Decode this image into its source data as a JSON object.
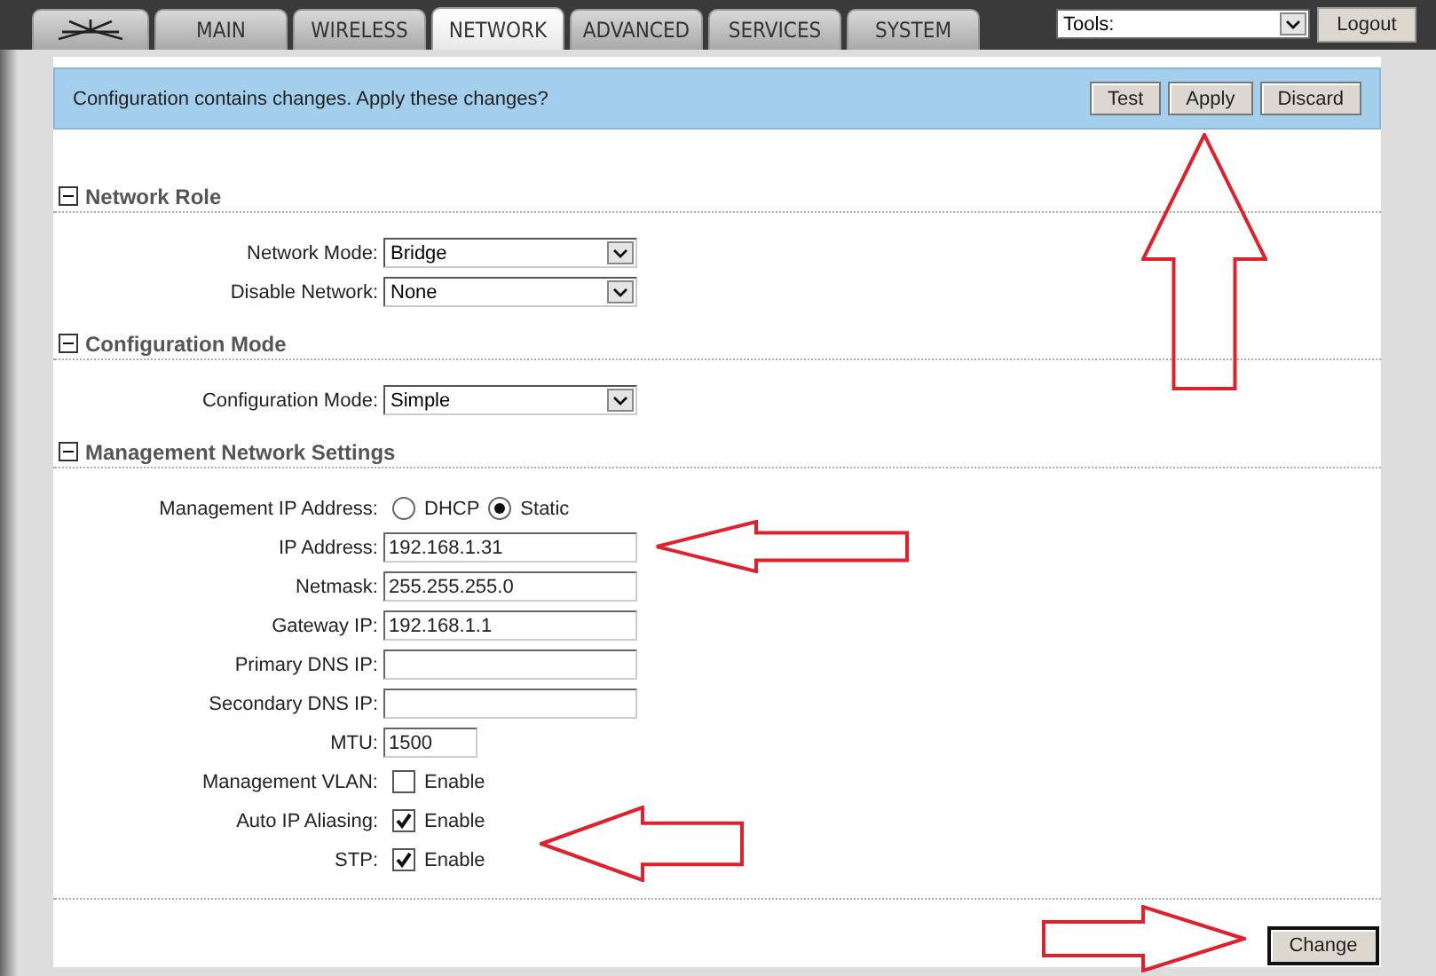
{
  "tabs": [
    {
      "kind": "logo",
      "selected": false
    },
    {
      "kind": "tab",
      "label": "MAIN",
      "selected": false
    },
    {
      "kind": "tab",
      "label": "WIRELESS",
      "selected": false
    },
    {
      "kind": "tab",
      "label": "NETWORK",
      "selected": true
    },
    {
      "kind": "tab",
      "label": "ADVANCED",
      "selected": false
    },
    {
      "kind": "tab",
      "label": "SERVICES",
      "selected": false
    },
    {
      "kind": "tab",
      "label": "SYSTEM",
      "selected": false
    }
  ],
  "tools": {
    "value": "Tools:"
  },
  "logout": "Logout",
  "banner": {
    "message": "Configuration contains changes. Apply these changes?",
    "buttons": [
      "Test",
      "Apply",
      "Discard"
    ]
  },
  "sections": [
    {
      "title": "Network Role",
      "expanded": true,
      "rows": [
        {
          "kind": "select",
          "label": "Network Mode:",
          "value": "Bridge"
        },
        {
          "kind": "select",
          "label": "Disable Network:",
          "value": "None"
        }
      ]
    },
    {
      "title": "Configuration Mode",
      "expanded": true,
      "rows": [
        {
          "kind": "select",
          "label": "Configuration Mode:",
          "value": "Simple"
        }
      ]
    },
    {
      "title": "Management Network Settings",
      "expanded": true,
      "rows": [
        {
          "kind": "radio",
          "label": "Management IP Address:",
          "options": [
            {
              "label": "DHCP",
              "selected": false
            },
            {
              "label": "Static",
              "selected": true
            }
          ]
        },
        {
          "kind": "text",
          "label": "IP Address:",
          "value": "192.168.1.31"
        },
        {
          "kind": "text",
          "label": "Netmask:",
          "value": "255.255.255.0"
        },
        {
          "kind": "text",
          "label": "Gateway IP:",
          "value": "192.168.1.1"
        },
        {
          "kind": "text",
          "label": "Primary DNS IP:"
        },
        {
          "kind": "text",
          "label": "Secondary DNS IP:"
        },
        {
          "kind": "short",
          "label": "MTU:",
          "value": "1500"
        },
        {
          "kind": "checkbox",
          "label": "Management VLAN:",
          "option": "Enable",
          "checked": false
        },
        {
          "kind": "checkbox",
          "label": "Auto IP Aliasing:",
          "option": "Enable",
          "checked": true
        },
        {
          "kind": "checkbox",
          "label": "STP:",
          "option": "Enable",
          "checked": true
        }
      ]
    }
  ],
  "change_button": "Change",
  "annotations": [
    {
      "kind": "up"
    },
    {
      "kind": "left"
    },
    {
      "kind": "left"
    },
    {
      "kind": "right"
    }
  ]
}
